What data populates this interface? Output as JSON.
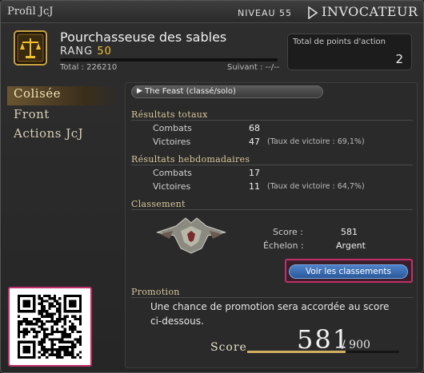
{
  "window": {
    "title": "Profil JcJ"
  },
  "header": {
    "level_label": "NIVEAU 55",
    "job": "INVOCATEUR",
    "character_name": "Pourchasseuse des sables",
    "rank_label": "RANG",
    "rank_value": "50",
    "total": "Total : 226210",
    "next": "Suivant : --/--",
    "action_points_label": "Total de points d'action",
    "action_points_value": "2"
  },
  "sidebar": {
    "items": [
      {
        "label": "Colisée"
      },
      {
        "label": "Front"
      },
      {
        "label": "Actions JcJ"
      }
    ]
  },
  "mode_select": {
    "value": "The Feast (classé/solo)"
  },
  "totals": {
    "heading": "Résultats totaux",
    "combats_label": "Combats",
    "combats_value": "68",
    "wins_label": "Victoires",
    "wins_value": "47",
    "win_rate": "(Taux de victoire : 69,1%)"
  },
  "weekly": {
    "heading": "Résultats hebdomadaires",
    "combats_label": "Combats",
    "combats_value": "17",
    "wins_label": "Victoires",
    "wins_value": "11",
    "win_rate": "(Taux de victoire : 64,7%)"
  },
  "ranking": {
    "heading": "Classement",
    "score_label": "Score :",
    "score_value": "581",
    "tier_label": "Échelon :",
    "tier_value": "Argent",
    "button_label": "Voir les classements"
  },
  "promotion": {
    "heading": "Promotion",
    "text": "Une chance de promotion sera accordée au score ci-dessous.",
    "score_word": "Score",
    "score_value": "581",
    "score_max": "/ 900",
    "progress_fraction": 0.645
  },
  "colors": {
    "accent_pink": "#c0306a",
    "gold": "#f0c030",
    "button_blue": "#3b6fb5"
  }
}
